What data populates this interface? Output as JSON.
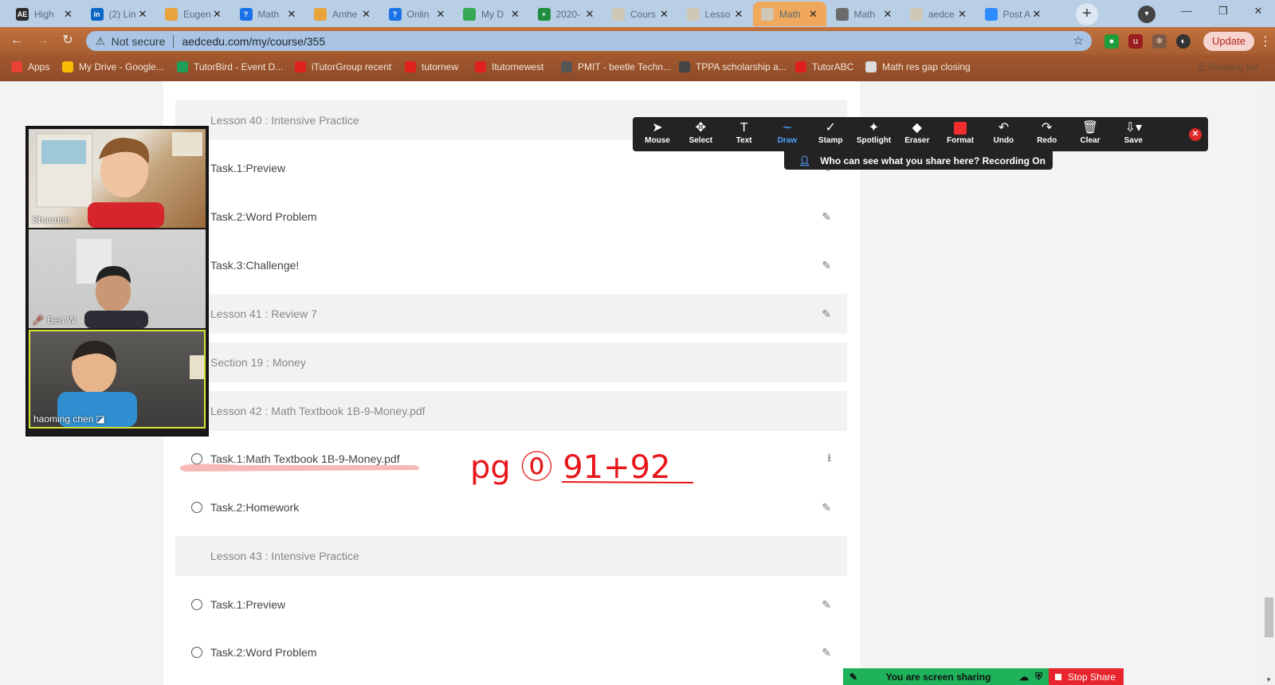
{
  "browser": {
    "tabs": [
      {
        "title": "High",
        "fav": "AE",
        "fav_color": "#2b2b2b"
      },
      {
        "title": "(2) Lin",
        "fav": "in",
        "fav_color": "#0a66c2"
      },
      {
        "title": "Eugen",
        "fav": "",
        "fav_color": "#e8a33a"
      },
      {
        "title": "Math",
        "fav": "?",
        "fav_color": "#1a73e8"
      },
      {
        "title": "Amhe",
        "fav": "",
        "fav_color": "#e8a33a"
      },
      {
        "title": "Onlin",
        "fav": "?",
        "fav_color": "#1a73e8"
      },
      {
        "title": "My D",
        "fav": "",
        "fav_color": "#34a853"
      },
      {
        "title": "2020-",
        "fav": "+",
        "fav_color": "#1e8e3e"
      },
      {
        "title": "Cours",
        "fav": "",
        "fav_color": "#cfc8b6"
      },
      {
        "title": "Lesso",
        "fav": "",
        "fav_color": "#cfc8b6"
      },
      {
        "title": "Math",
        "fav": "",
        "fav_color": "#cfc8b6"
      },
      {
        "title": "Math",
        "fav": "",
        "fav_color": "#6b6b6b"
      },
      {
        "title": "aedce",
        "fav": "",
        "fav_color": "#cfc8b6"
      },
      {
        "title": "Post A",
        "fav": "",
        "fav_color": "#2d8cff"
      }
    ],
    "address": {
      "security": "Not secure",
      "url": "aedcedu.com/my/course/355"
    },
    "update_label": "Update",
    "bookmarks": [
      {
        "label": "Apps",
        "color": "#e94235"
      },
      {
        "label": "My Drive - Google...",
        "color": "#fbbc04"
      },
      {
        "label": "TutorBird - Event D...",
        "color": "#1e9e5a"
      },
      {
        "label": "iTutorGroup recent",
        "color": "#e0201c"
      },
      {
        "label": "tutornew",
        "color": "#e0201c"
      },
      {
        "label": "Itutornewest",
        "color": "#e0201c"
      },
      {
        "label": "PMIT - beetle Techn...",
        "color": "#555555"
      },
      {
        "label": "TPPA scholarship a...",
        "color": "#444444"
      },
      {
        "label": "TutorABC",
        "color": "#e0201c"
      },
      {
        "label": "Math res gap closing",
        "color": "#dddddd"
      }
    ],
    "reading_list": "Reading list"
  },
  "course": {
    "rows": [
      {
        "label": "Lesson 40 : Intensive Practice",
        "style": "grey",
        "radio": false,
        "action": ""
      },
      {
        "label": "Task.1:Preview",
        "style": "white",
        "radio": false,
        "action": "edit"
      },
      {
        "label": "Task.2:Word Problem",
        "style": "white",
        "radio": false,
        "action": "edit"
      },
      {
        "label": "Task.3:Challenge!",
        "style": "white",
        "radio": false,
        "action": "edit"
      },
      {
        "label": "Lesson 41 : Review 7",
        "style": "grey",
        "radio": false,
        "action": "edit"
      },
      {
        "label": "Section 19 : Money",
        "style": "grey",
        "radio": false,
        "action": ""
      },
      {
        "label": "Lesson 42 : Math Textbook 1B-9-Money.pdf",
        "style": "grey",
        "radio": false,
        "action": ""
      },
      {
        "label": "Task.1:Math Textbook 1B-9-Money.pdf",
        "style": "white",
        "radio": true,
        "action": "download"
      },
      {
        "label": "Task.2:Homework",
        "style": "white",
        "radio": true,
        "action": "edit"
      },
      {
        "label": "Lesson 43 : Intensive Practice",
        "style": "grey",
        "radio": false,
        "action": ""
      },
      {
        "label": "Task.1:Preview",
        "style": "white",
        "radio": true,
        "action": "edit"
      },
      {
        "label": "Task.2:Word Problem",
        "style": "white",
        "radio": true,
        "action": "edit"
      }
    ]
  },
  "video": {
    "participants": [
      {
        "name": "Shannon",
        "muted": false
      },
      {
        "name": "Ben W",
        "muted": true
      },
      {
        "name": "haoming   chen",
        "muted": false
      }
    ]
  },
  "annotation": {
    "tools": [
      {
        "label": "Mouse",
        "icon": "mouse-pointer-icon",
        "glyph": "➤"
      },
      {
        "label": "Select",
        "icon": "move-icon",
        "glyph": "✥"
      },
      {
        "label": "Text",
        "icon": "text-icon",
        "glyph": "T"
      },
      {
        "label": "Draw",
        "icon": "draw-icon",
        "glyph": "∼",
        "active": true
      },
      {
        "label": "Stamp",
        "icon": "check-icon",
        "glyph": "✓"
      },
      {
        "label": "Spotlight",
        "icon": "spotlight-icon",
        "glyph": "✦"
      },
      {
        "label": "Eraser",
        "icon": "eraser-icon",
        "glyph": "◆"
      },
      {
        "label": "Format",
        "icon": "format-icon",
        "glyph": ""
      },
      {
        "label": "Undo",
        "icon": "undo-icon",
        "glyph": "↶"
      },
      {
        "label": "Redo",
        "icon": "redo-icon",
        "glyph": "↷"
      },
      {
        "label": "Clear",
        "icon": "trash-icon",
        "glyph": "🗑"
      },
      {
        "label": "Save",
        "icon": "save-icon",
        "glyph": "⇩▾"
      }
    ],
    "recording_text": "Who can see what you share here? Recording On",
    "ink_text": "pg ⓪ 91+92"
  },
  "share": {
    "status": "You are screen sharing",
    "stop_label": "Stop Share"
  },
  "colors": {
    "active_tab": "#f0a85c",
    "accent_blue": "#4ea3ff",
    "ink_red": "#e8161b",
    "share_green": "#1eb25a",
    "stop_red": "#e8242c"
  }
}
